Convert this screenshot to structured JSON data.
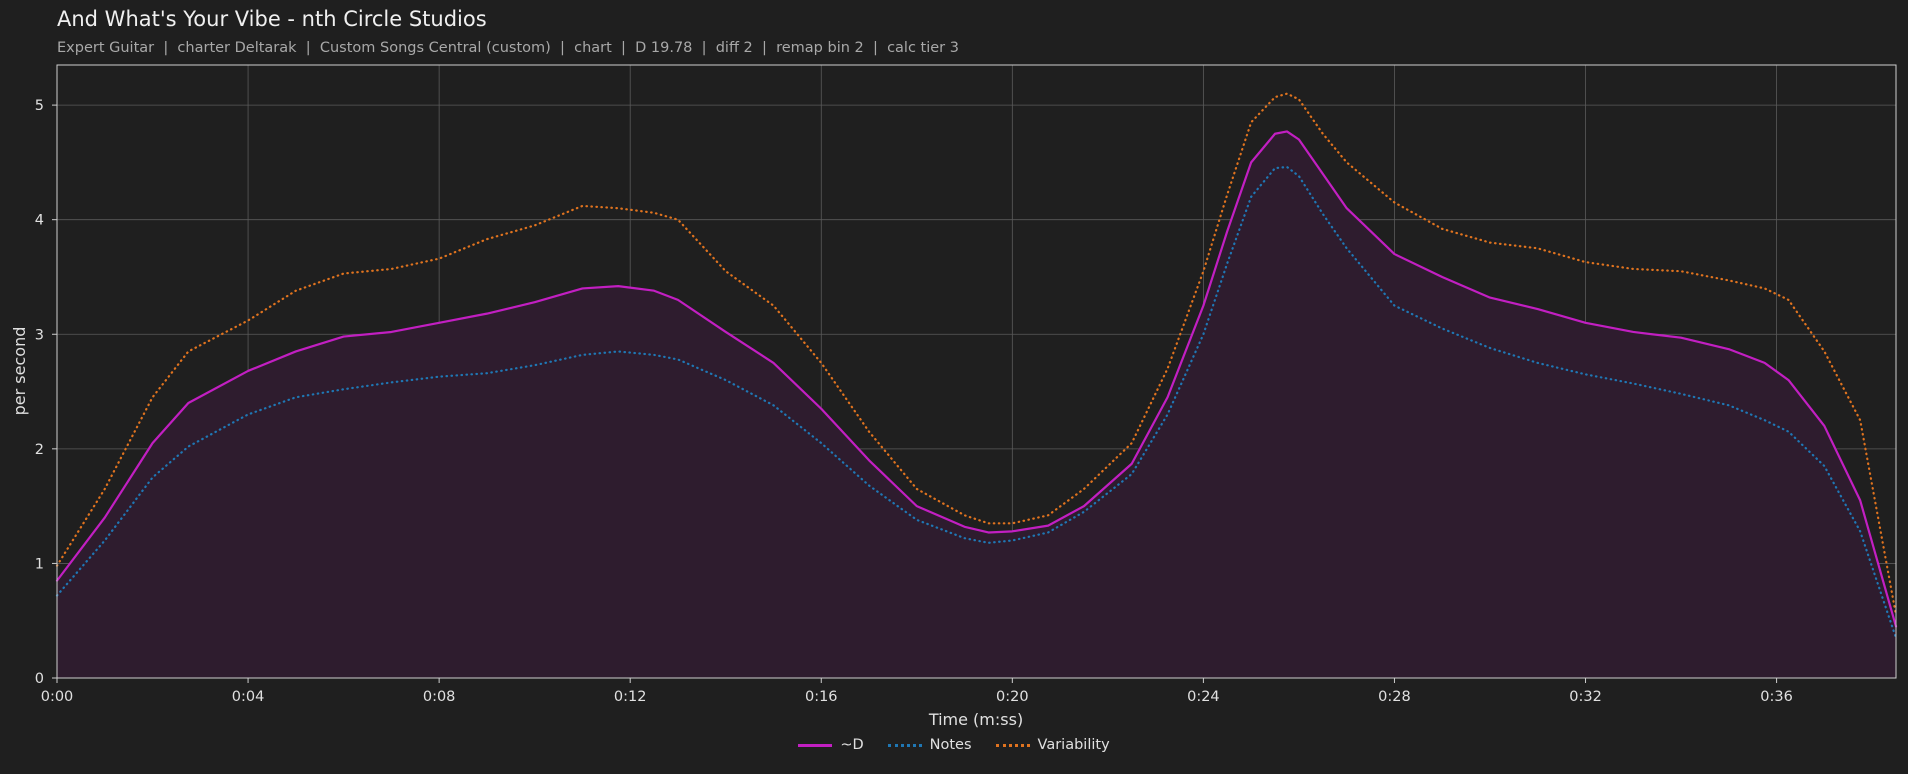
{
  "header": {
    "title": "And What's Your Vibe - nth Circle Studios",
    "subtitle": "Expert Guitar  |  charter Deltarak  |  Custom Songs Central (custom)  |  chart  |  D 19.78  |  diff 2  |  remap bin 2  |  calc tier 3"
  },
  "colors": {
    "background": "#1f1f1f",
    "grid": "#5a5a5a",
    "fill": "#2e1c2e",
    "d": "#c21fc2",
    "notes": "#1f77b4",
    "variability": "#e0731f"
  },
  "chart_data": {
    "type": "line",
    "xlabel": "Time (m:ss)",
    "ylabel": "per second",
    "xlim": [
      0,
      38.5
    ],
    "ylim": [
      0,
      5.35
    ],
    "grid": true,
    "legend_placement": "bottom-center",
    "x_ticks": [
      {
        "value": 0,
        "label": "0:00"
      },
      {
        "value": 4,
        "label": "0:04"
      },
      {
        "value": 8,
        "label": "0:08"
      },
      {
        "value": 12,
        "label": "0:12"
      },
      {
        "value": 16,
        "label": "0:16"
      },
      {
        "value": 20,
        "label": "0:20"
      },
      {
        "value": 24,
        "label": "0:24"
      },
      {
        "value": 28,
        "label": "0:28"
      },
      {
        "value": 32,
        "label": "0:32"
      },
      {
        "value": 36,
        "label": "0:36"
      }
    ],
    "y_ticks": [
      {
        "value": 0,
        "label": "0"
      },
      {
        "value": 1,
        "label": "1"
      },
      {
        "value": 2,
        "label": "2"
      },
      {
        "value": 3,
        "label": "3"
      },
      {
        "value": 4,
        "label": "4"
      },
      {
        "value": 5,
        "label": "5"
      }
    ],
    "x": [
      0,
      1,
      2,
      2.75,
      4,
      5,
      6,
      7,
      8,
      9,
      10,
      11,
      11.75,
      12.5,
      13,
      14,
      15,
      16,
      17,
      18,
      19,
      19.5,
      20,
      20.75,
      21.5,
      22.5,
      23.25,
      24,
      24.5,
      25,
      25.5,
      25.75,
      26,
      26.5,
      27,
      28,
      29,
      30,
      31,
      32,
      33,
      34,
      35,
      35.75,
      36.25,
      37,
      37.75,
      38.5
    ],
    "series": [
      {
        "name": "~D",
        "style": "solid",
        "color": "#c21fc2",
        "values": [
          0.85,
          1.4,
          2.05,
          2.4,
          2.68,
          2.85,
          2.98,
          3.02,
          3.1,
          3.18,
          3.28,
          3.4,
          3.42,
          3.38,
          3.3,
          3.02,
          2.75,
          2.35,
          1.9,
          1.5,
          1.32,
          1.27,
          1.28,
          1.33,
          1.5,
          1.87,
          2.45,
          3.25,
          3.9,
          4.5,
          4.75,
          4.77,
          4.7,
          4.4,
          4.1,
          3.7,
          3.5,
          3.32,
          3.22,
          3.1,
          3.02,
          2.97,
          2.87,
          2.75,
          2.6,
          2.2,
          1.55,
          0.45
        ]
      },
      {
        "name": "Notes",
        "style": "dotted",
        "color": "#1f77b4",
        "values": [
          0.72,
          1.2,
          1.75,
          2.02,
          2.3,
          2.45,
          2.52,
          2.58,
          2.63,
          2.66,
          2.73,
          2.82,
          2.85,
          2.82,
          2.78,
          2.6,
          2.38,
          2.05,
          1.68,
          1.38,
          1.22,
          1.18,
          1.2,
          1.27,
          1.45,
          1.78,
          2.3,
          3.0,
          3.62,
          4.2,
          4.45,
          4.46,
          4.38,
          4.05,
          3.75,
          3.25,
          3.05,
          2.88,
          2.75,
          2.65,
          2.57,
          2.48,
          2.38,
          2.25,
          2.15,
          1.85,
          1.28,
          0.35
        ]
      },
      {
        "name": "Variability",
        "style": "dotted",
        "color": "#e0731f",
        "values": [
          0.98,
          1.65,
          2.45,
          2.85,
          3.12,
          3.38,
          3.53,
          3.57,
          3.66,
          3.83,
          3.95,
          4.12,
          4.1,
          4.06,
          4.0,
          3.55,
          3.25,
          2.75,
          2.15,
          1.65,
          1.42,
          1.35,
          1.35,
          1.42,
          1.65,
          2.05,
          2.7,
          3.55,
          4.22,
          4.85,
          5.07,
          5.1,
          5.05,
          4.75,
          4.5,
          4.15,
          3.92,
          3.8,
          3.75,
          3.63,
          3.57,
          3.55,
          3.47,
          3.4,
          3.3,
          2.85,
          2.25,
          0.55
        ]
      }
    ]
  }
}
